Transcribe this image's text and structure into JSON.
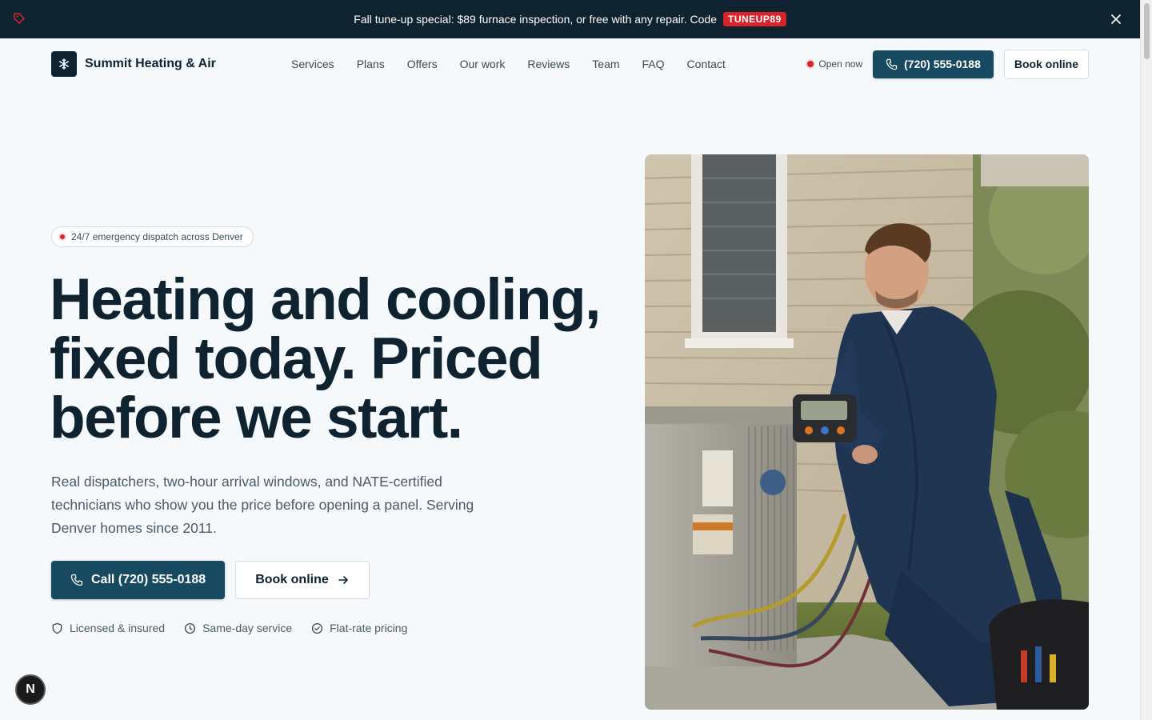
{
  "promo": {
    "text": "Fall tune-up special: $89 furnace inspection, or free with any repair. Code",
    "code": "TUNEUP89",
    "icon": "tag-icon",
    "close_icon": "close-icon"
  },
  "brand": {
    "name": "Summit Heating & Air",
    "logo_icon": "snowflake-icon"
  },
  "nav": {
    "items": [
      "Services",
      "Plans",
      "Offers",
      "Our work",
      "Reviews",
      "Team",
      "FAQ",
      "Contact"
    ]
  },
  "header_actions": {
    "status": "Open now",
    "phone": "(720) 555-0188",
    "book": "Book online"
  },
  "hero": {
    "badge": "24/7 emergency dispatch across Denver",
    "headline_line1": "Heating and cooling,",
    "headline_line2": "fixed today. Priced",
    "headline_line3": "before we start.",
    "subtext": "Real dispatchers, two-hour arrival windows, and NATE-certified technicians who show you the price before opening a panel. Serving Denver homes since 2011.",
    "call_label": "Call (720) 555-0188",
    "book_label": "Book online",
    "trust": [
      "Licensed & insured",
      "Same-day service",
      "Flat-rate pricing"
    ]
  },
  "fab": {
    "label": "N"
  },
  "colors": {
    "navy": "#0f2230",
    "teal": "#174a60",
    "accent_red": "#d8232a",
    "background": "#f5f9fb"
  }
}
